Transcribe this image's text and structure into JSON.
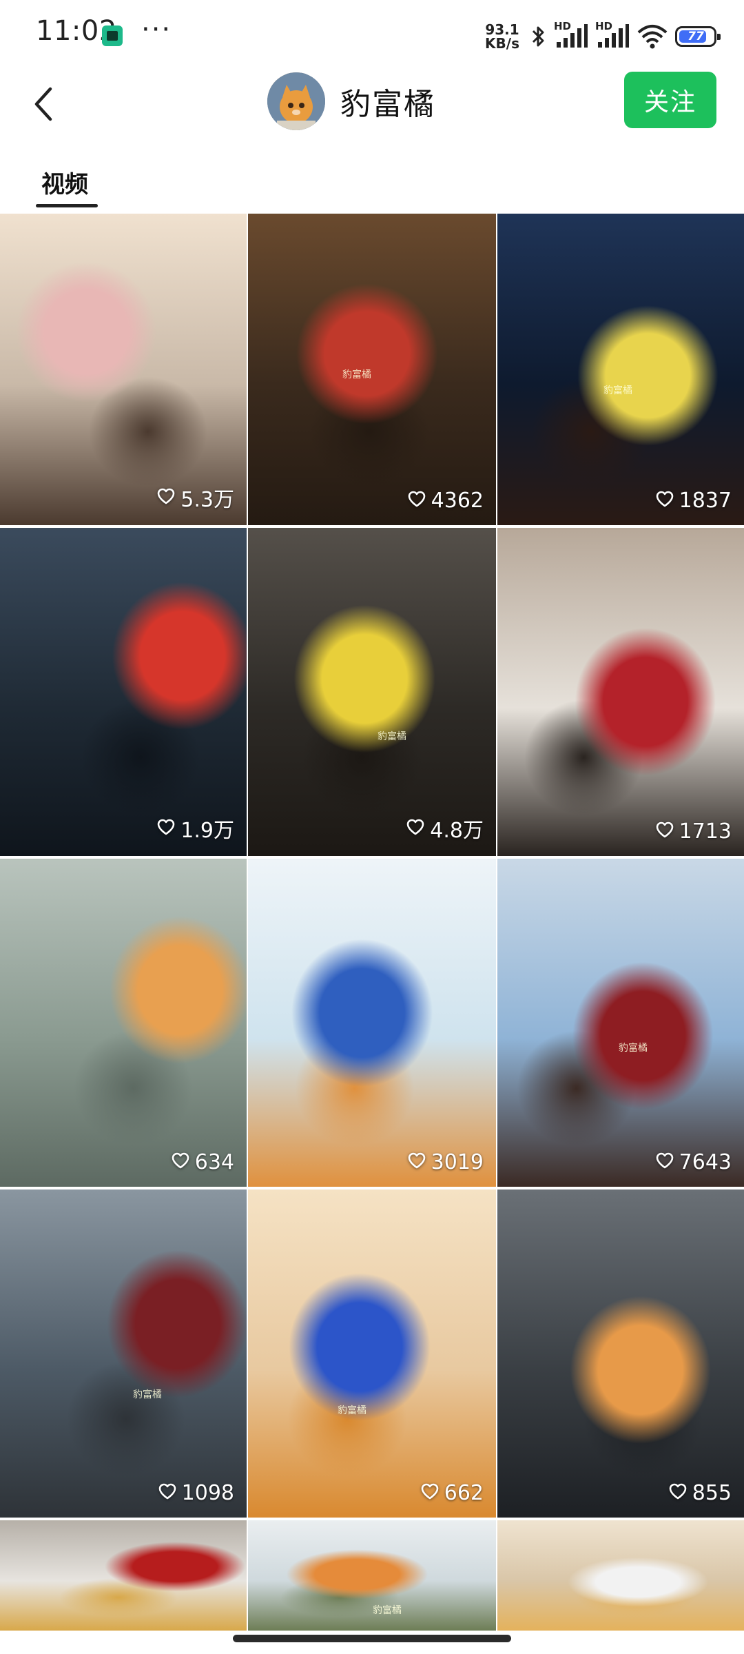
{
  "status_bar": {
    "time": "11:02",
    "more": "···",
    "net_speed_value": "93.1",
    "net_speed_unit": "KB/s",
    "signal1_label": "HD",
    "signal2_label": "HD",
    "battery_level": "77"
  },
  "header": {
    "profile_name": "豹富橘",
    "follow_label": "关注"
  },
  "tabs": {
    "video": "视频"
  },
  "videos": [
    {
      "likes": "5.3万",
      "palette": [
        "#c9b9a8",
        "#f0e1cf",
        "#e8b7b5",
        "#4b3a2f"
      ],
      "watermark": ""
    },
    {
      "likes": "4362",
      "palette": [
        "#3a2a1d",
        "#6a4a2e",
        "#c0392b",
        "#241a12"
      ],
      "watermark": "豹富橘"
    },
    {
      "likes": "1837",
      "palette": [
        "#0e1a2e",
        "#1f3457",
        "#e8d44d",
        "#2a1a14"
      ],
      "watermark": "豹富橘"
    },
    {
      "likes": "1.9万",
      "palette": [
        "#1f2a35",
        "#3b4b5d",
        "#d6362b",
        "#0f151c"
      ],
      "watermark": ""
    },
    {
      "likes": "4.8万",
      "palette": [
        "#2d2a26",
        "#55504a",
        "#e8cf3a",
        "#1c1814"
      ],
      "watermark": "豹富橘"
    },
    {
      "likes": "1713",
      "palette": [
        "#e6e1da",
        "#b7a899",
        "#b4222a",
        "#2a2420"
      ],
      "watermark": ""
    },
    {
      "likes": "634",
      "palette": [
        "#8a9a90",
        "#b9c4bd",
        "#e8a050",
        "#5d6a62"
      ],
      "watermark": ""
    },
    {
      "likes": "3019",
      "palette": [
        "#cfe3ee",
        "#eef4f8",
        "#2f5fbf",
        "#e0913e"
      ],
      "watermark": ""
    },
    {
      "likes": "7643",
      "palette": [
        "#8fb3d6",
        "#c9d8e6",
        "#8e1d22",
        "#3b2a24"
      ],
      "watermark": "豹富橘"
    },
    {
      "likes": "1098",
      "palette": [
        "#4d5a66",
        "#8a96a0",
        "#7a1f24",
        "#2e3338"
      ],
      "watermark": "豹富橘"
    },
    {
      "likes": "662",
      "palette": [
        "#e8c9a0",
        "#f5e2c4",
        "#2c55c9",
        "#d9892f"
      ],
      "watermark": "豹富橘"
    },
    {
      "likes": "855",
      "palette": [
        "#3a3f44",
        "#6a7076",
        "#e79a49",
        "#1d2024"
      ],
      "watermark": ""
    },
    {
      "likes": "",
      "palette": [
        "#e7e4df",
        "#b6b0a8",
        "#b61d1d",
        "#d8a84a"
      ],
      "watermark": ""
    },
    {
      "likes": "",
      "palette": [
        "#cfd9dd",
        "#eaeef0",
        "#e58b3a",
        "#6d7d55"
      ],
      "watermark": "豹富橘"
    },
    {
      "likes": "",
      "palette": [
        "#d9c6a8",
        "#efe3d0",
        "#f2f2f2",
        "#e4b25c"
      ],
      "watermark": ""
    }
  ]
}
